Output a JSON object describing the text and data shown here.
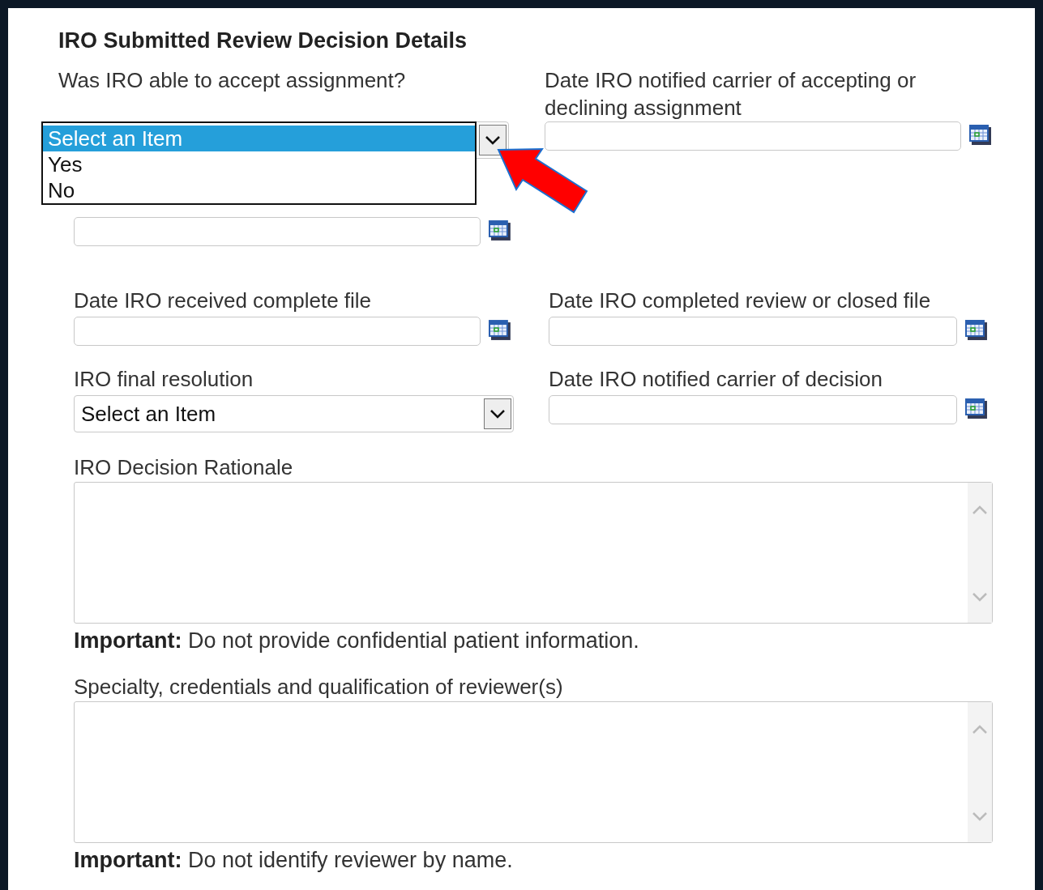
{
  "title": "IRO Submitted Review Decision Details",
  "accept_assignment": {
    "label": "Was IRO able to accept assignment?",
    "expanded": true,
    "options": [
      {
        "label": "Select an Item",
        "selected": true
      },
      {
        "label": "Yes",
        "selected": false
      },
      {
        "label": "No",
        "selected": false
      }
    ]
  },
  "notified_accepting": {
    "label": "Date IRO notified carrier of accepting or declining assignment"
  },
  "rows": [
    [
      {
        "kind": "date"
      }
    ],
    [
      {
        "kind": "date",
        "label": "Date IRO received complete file"
      },
      {
        "kind": "date",
        "label": "Date IRO completed review or closed file"
      }
    ],
    [
      {
        "kind": "select",
        "label": "IRO final resolution",
        "value": "Select an Item"
      },
      {
        "kind": "date",
        "label": "Date IRO notified carrier of decision"
      }
    ]
  ],
  "text_areas": [
    {
      "label": "IRO Decision Rationale",
      "note": "**Important:** Do not provide confidential patient information."
    },
    {
      "label": "Specialty, credentials and qualification of reviewer(s)",
      "note": "**Important:** Do not identify reviewer by name."
    }
  ]
}
